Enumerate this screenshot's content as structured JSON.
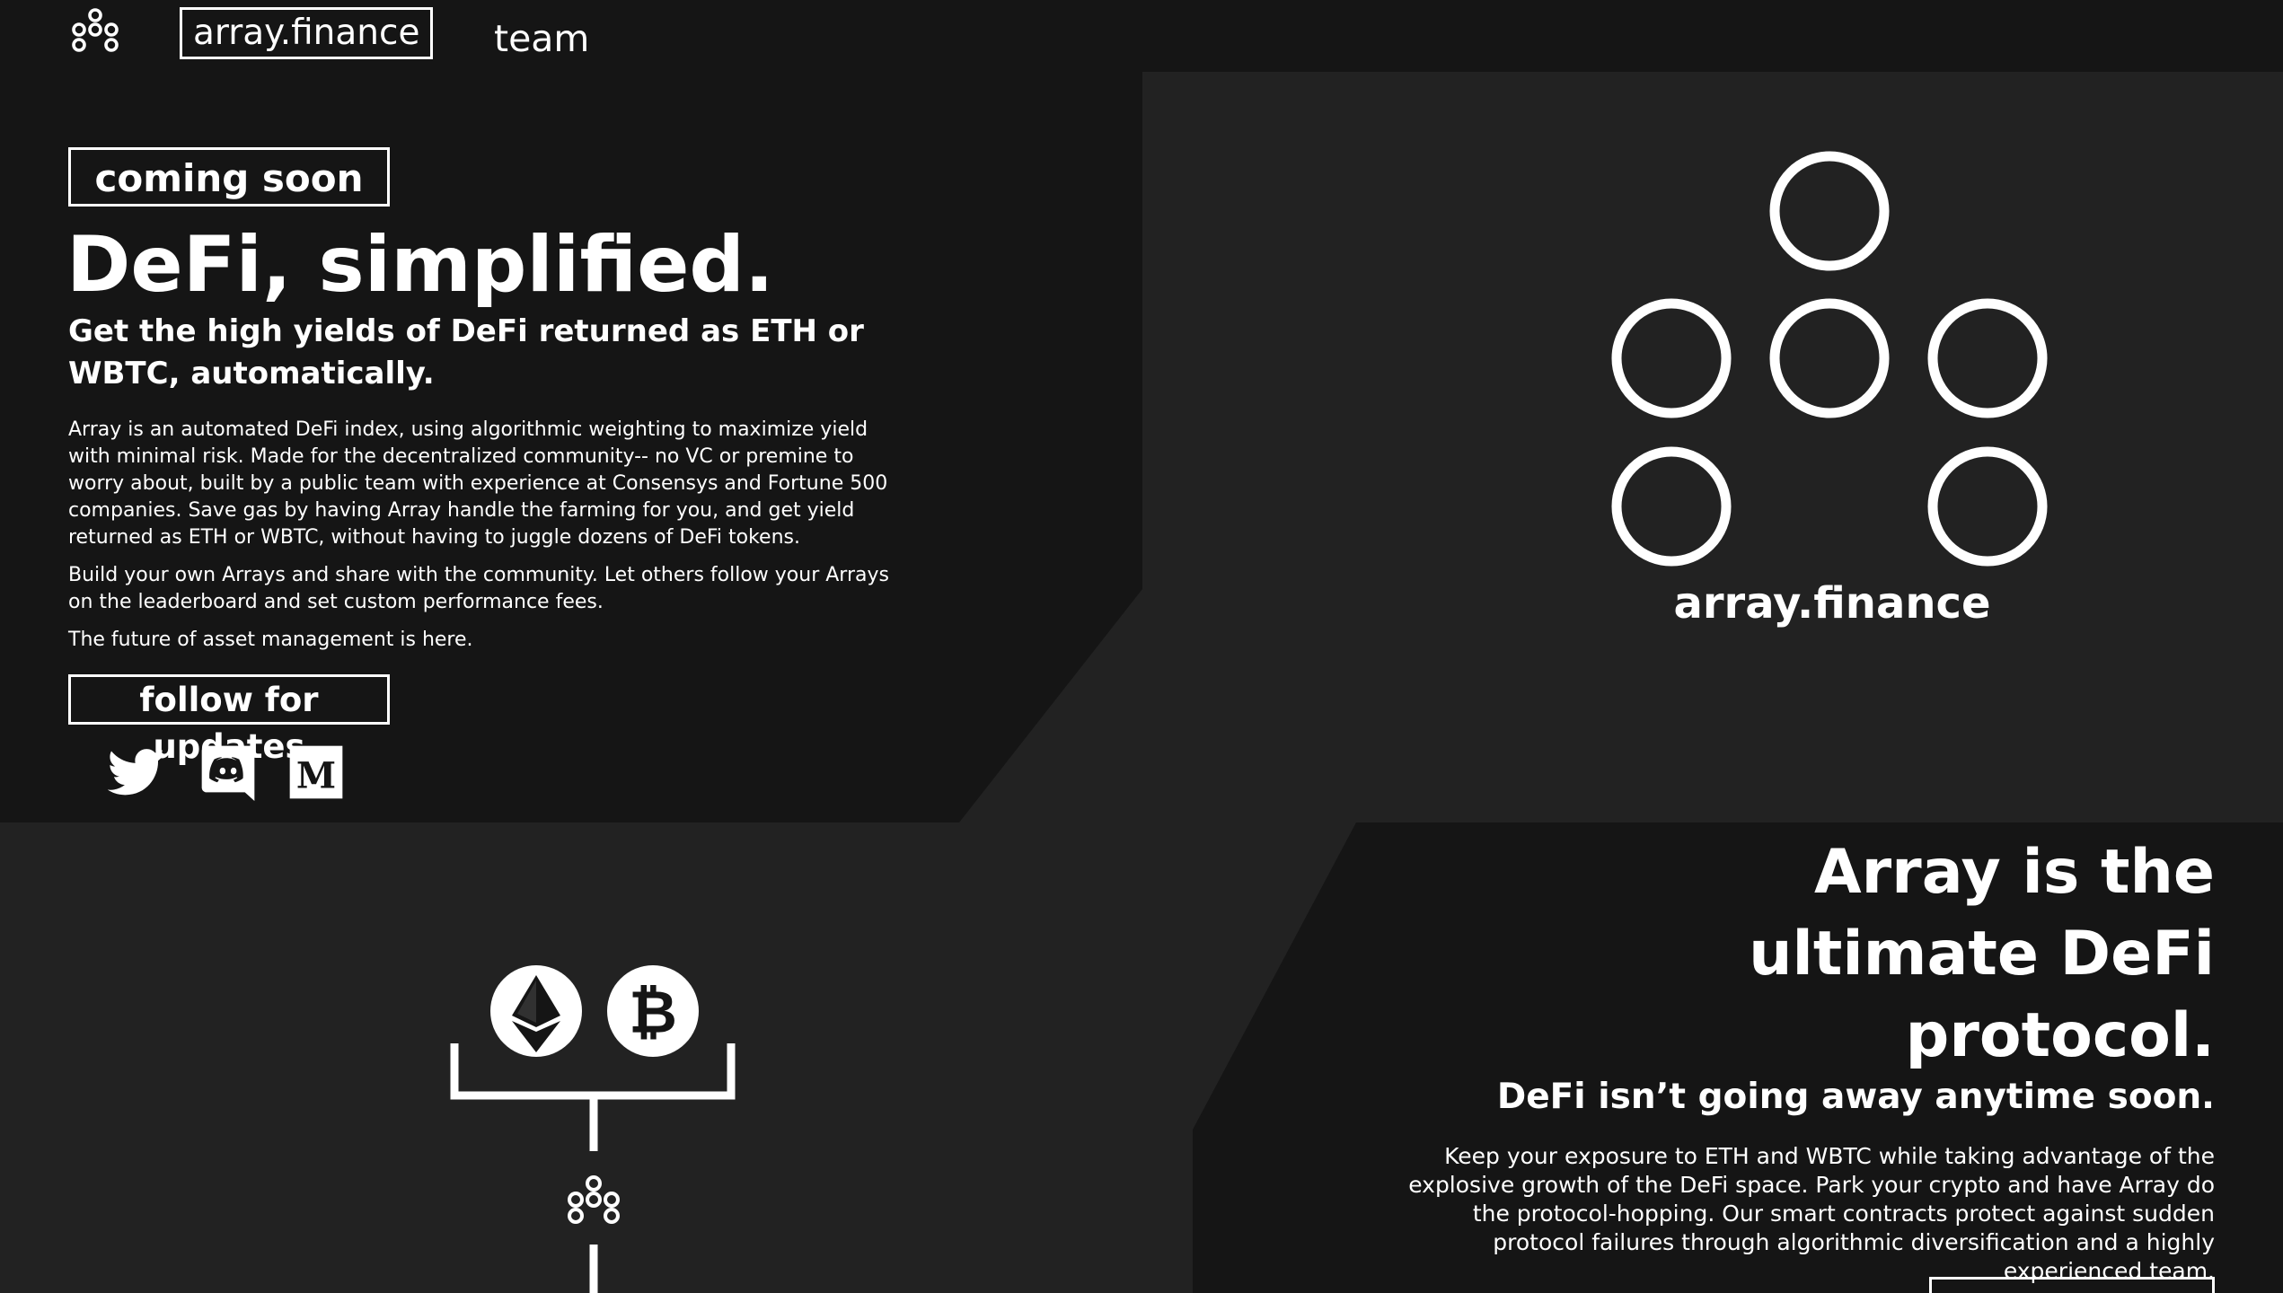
{
  "nav": {
    "logo_icon": "array-dots-logo-icon",
    "brand": "array.finance",
    "team": "team"
  },
  "hero": {
    "badge": "coming soon",
    "title": "DeFi, simplified.",
    "subtitle": "Get the high yields of DeFi returned as ETH or WBTC, automatically.",
    "paragraphs": [
      "Array is an automated DeFi index, using algorithmic weighting to maximize yield with minimal risk. Made for the decentralized community-- no VC or premine to worry about, built by a public team with experience at Consensys and Fortune 500 companies. Save gas by having Array handle the farming for you, and get yield returned as ETH or WBTC, without having to juggle dozens of DeFi tokens.",
      "Build your own Arrays and share with the community. Let others follow your Arrays on the leaderboard and set custom performance fees.",
      "The future of asset management is here."
    ],
    "follow_label": "follow for updates",
    "social": [
      {
        "name": "twitter",
        "icon": "twitter-icon"
      },
      {
        "name": "discord",
        "icon": "discord-icon"
      },
      {
        "name": "medium",
        "icon": "medium-icon"
      }
    ]
  },
  "logo_panel": {
    "icon": "array-dots-logo-icon",
    "text": "array.finance"
  },
  "flow_illustration": {
    "icons": [
      "ethereum-icon",
      "bitcoin-icon",
      "array-dots-logo-icon"
    ]
  },
  "protocol": {
    "title_lines": [
      "Array is the",
      "ultimate DeFi",
      "protocol."
    ],
    "subtitle": "DeFi isn’t going away anytime soon.",
    "body": "Keep your exposure to ETH and WBTC while taking advantage of the explosive growth of the DeFi space. Park your crypto and have Array do the protocol-hopping. Our smart contracts protect against sudden protocol failures through algorithmic diversification and a highly experienced team."
  },
  "colors": {
    "background_dark": "#151515",
    "background_panel": "#222222",
    "foreground": "#ffffff"
  }
}
